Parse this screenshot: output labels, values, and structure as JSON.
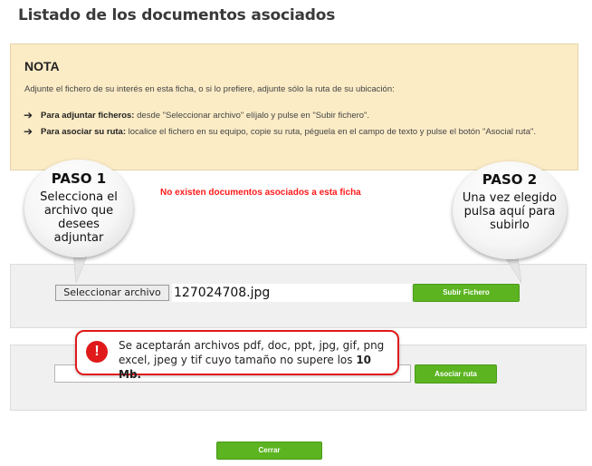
{
  "page": {
    "title": "Listado de los documentos asociados"
  },
  "nota": {
    "title": "NOTA",
    "intro": "Adjunte el fichero de su interés en esta ficha, o si lo prefiere, adjunte sólo la ruta de su ubicación:",
    "items": [
      {
        "bold": "Para adjuntar ficheros:",
        "text": " desde \"Seleccionar archivo\" elíjalo y pulse en \"Subir fichero\"."
      },
      {
        "bold": "Para asociar su ruta:",
        "text": " localice el fichero en su equipo, copie su ruta, péguela en el campo de texto y pulse el botón \"Asocial ruta\"."
      }
    ]
  },
  "bubbles": {
    "paso1": {
      "title": "PASO 1",
      "text": "Selecciona el archivo que desees adjuntar"
    },
    "paso2": {
      "title": "PASO 2",
      "text": "Una vez elegido pulsa aquí para subirlo"
    }
  },
  "status": {
    "no_docs": "No existen documentos asociados a esta ficha"
  },
  "upload": {
    "select_label": "Seleccionar archivo",
    "file_name": "127024708.jpg",
    "submit_label": "Subir Fichero"
  },
  "route": {
    "value": "",
    "submit_label": "Asociar ruta"
  },
  "warning": {
    "icon": "!",
    "text": "Se aceptarán archivos pdf, doc, ppt, jpg, gif, png excel, jpeg y tif cuyo tamaño no supere los ",
    "bold": "10 Mb."
  },
  "footer": {
    "close_label": "Cerrar"
  },
  "colors": {
    "accent": "#5cb421",
    "warning": "#e01a1a",
    "note_bg": "#fcecc6",
    "status": "#ff1a1a"
  }
}
